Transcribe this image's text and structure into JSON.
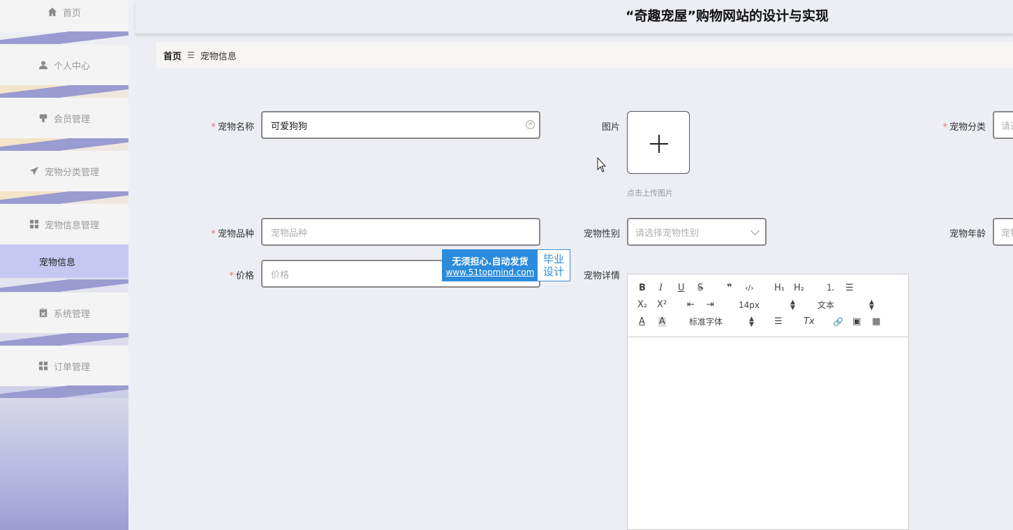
{
  "header": {
    "title": "“奇趣宠屋”购物网站的设计与实现"
  },
  "sidebar": {
    "items": [
      {
        "label": "首页",
        "icon": "home-icon"
      },
      {
        "label": "个人中心",
        "icon": "user-icon"
      },
      {
        "label": "会员管理",
        "icon": "member-icon"
      },
      {
        "label": "宠物分类管理",
        "icon": "paper-plane-icon"
      },
      {
        "label": "宠物信息管理",
        "icon": "grid-icon"
      },
      {
        "label": "系统管理",
        "icon": "clipboard-icon"
      },
      {
        "label": "订单管理",
        "icon": "grid-icon"
      }
    ],
    "sub_item": "宠物信息"
  },
  "breadcrumb": {
    "home": "首页",
    "separator": "☰",
    "current": "宠物信息"
  },
  "form": {
    "pet_name": {
      "label": "宠物名称",
      "value": "可爱狗狗"
    },
    "image": {
      "label": "图片",
      "hint": "点击上传图片"
    },
    "category": {
      "label": "宠物分类",
      "placeholder": "请选"
    },
    "breed": {
      "label": "宠物品种",
      "placeholder": "宠物品种"
    },
    "gender": {
      "label": "宠物性别",
      "placeholder": "请选择宠物性别"
    },
    "age": {
      "label": "宠物年龄",
      "placeholder": "宠物"
    },
    "price": {
      "label": "价格",
      "placeholder": "价格"
    },
    "details": {
      "label": "宠物详情"
    }
  },
  "editor": {
    "bold": "B",
    "italic": "I",
    "underline": "U",
    "strike": "S",
    "quote": "❞",
    "code": "‹/›",
    "h1": "H₁",
    "h2": "H₂",
    "ol": "⒈",
    "ul": "☰",
    "sub": "X₂",
    "sup": "X²",
    "outdent": "⇤",
    "indent": "⇥",
    "font_size": "14px",
    "block_type": "文本",
    "font_color": "A",
    "bg_color": "A",
    "font_family": "标准字体",
    "align": "☰",
    "clear": "Tx",
    "link": "🔗",
    "image": "▣",
    "video": "▦"
  },
  "watermark": {
    "line1": "无须担心.自动发货",
    "line2": "www.51topmind.com",
    "right1": "毕业",
    "right2": "设计"
  },
  "colors": {
    "accent_sub": "#c7c8f2",
    "required": "#f56c6c",
    "watermark": "#2b8bdc"
  }
}
